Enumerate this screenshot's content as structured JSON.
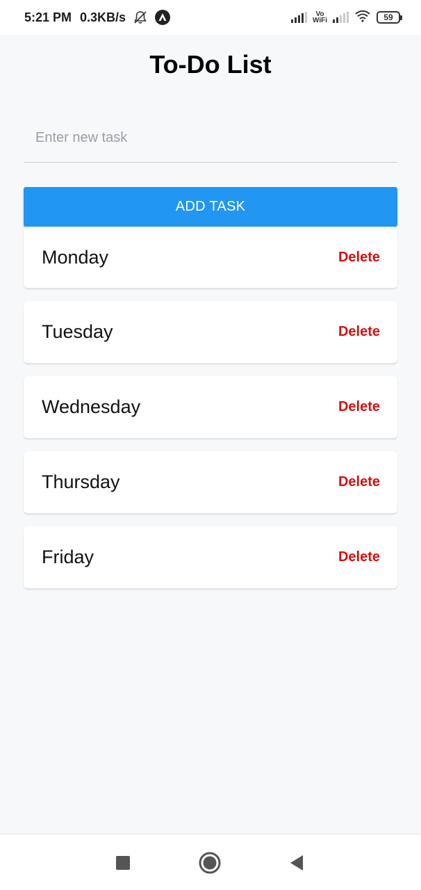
{
  "status_bar": {
    "time": "5:21 PM",
    "net_speed": "0.3KB/s",
    "battery": "59",
    "icons": [
      "bell-off-icon",
      "app-notification-icon",
      "signal-icon",
      "vowifi-icon",
      "wifi-icon",
      "battery-icon"
    ]
  },
  "header": {
    "title": "To-Do List"
  },
  "form": {
    "placeholder": "Enter new task",
    "value": "",
    "add_label": "ADD TASK"
  },
  "tasks": [
    {
      "label": "Monday",
      "delete_label": "Delete"
    },
    {
      "label": "Tuesday",
      "delete_label": "Delete"
    },
    {
      "label": "Wednesday",
      "delete_label": "Delete"
    },
    {
      "label": "Thursday",
      "delete_label": "Delete"
    },
    {
      "label": "Friday",
      "delete_label": "Delete"
    }
  ],
  "nav": {
    "icons": [
      "recent-apps-icon",
      "home-icon",
      "back-icon"
    ]
  },
  "colors": {
    "accent": "#2196f3",
    "delete": "#d80f0f",
    "background": "#f7f8fa",
    "card": "#ffffff"
  }
}
